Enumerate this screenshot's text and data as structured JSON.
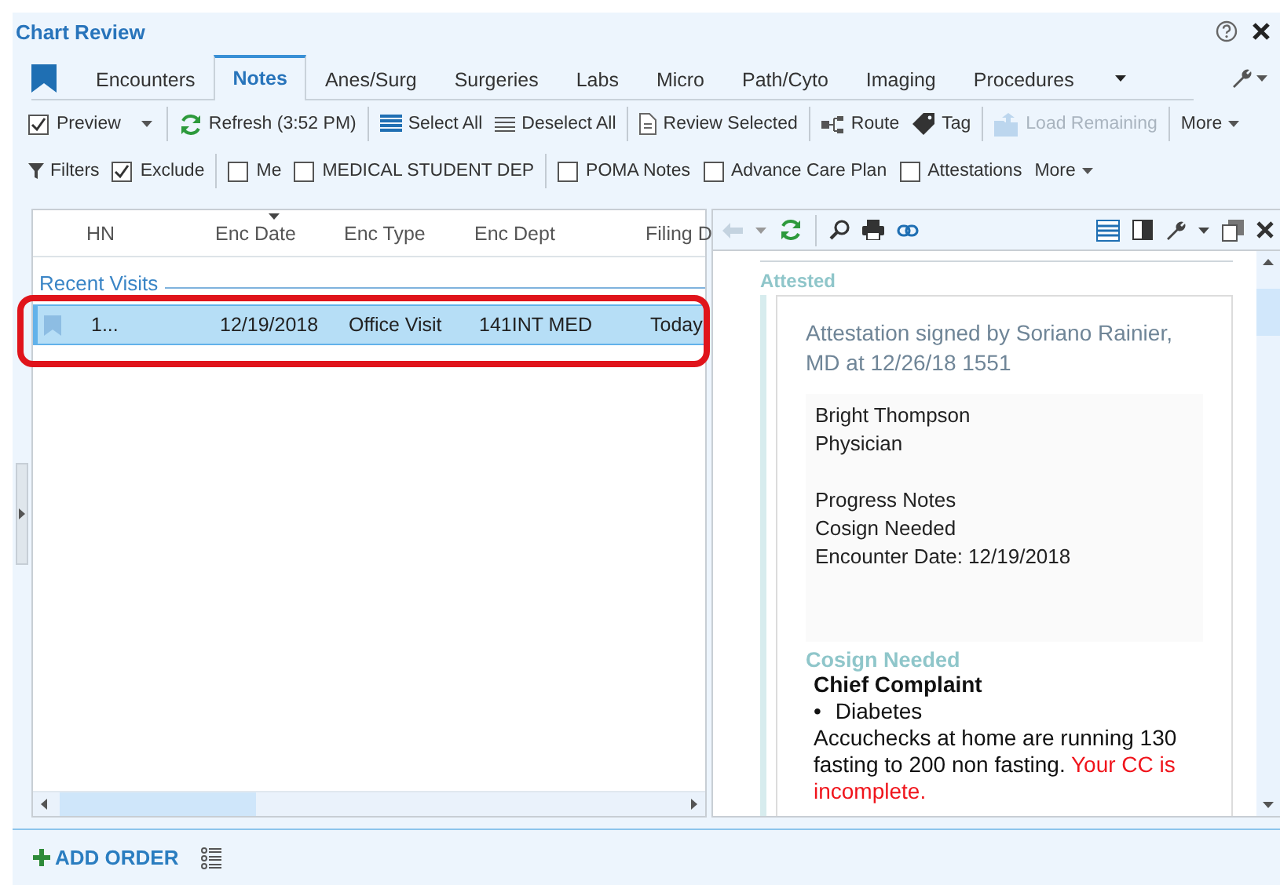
{
  "window": {
    "title": "Chart Review"
  },
  "tabs": [
    {
      "label": "Encounters",
      "selected": false
    },
    {
      "label": "Notes",
      "selected": true
    },
    {
      "label": "Anes/Surg",
      "selected": false
    },
    {
      "label": "Surgeries",
      "selected": false
    },
    {
      "label": "Labs",
      "selected": false
    },
    {
      "label": "Micro",
      "selected": false
    },
    {
      "label": "Path/Cyto",
      "selected": false
    },
    {
      "label": "Imaging",
      "selected": false
    },
    {
      "label": "Procedures",
      "selected": false
    }
  ],
  "toolbar": {
    "items": [
      {
        "kind": "checkbox",
        "label": "Preview",
        "checked": true,
        "dropdown": true
      },
      {
        "kind": "separator"
      },
      {
        "kind": "button",
        "label": "Refresh (3:52 PM)",
        "disabled": false
      },
      {
        "kind": "separator"
      },
      {
        "kind": "button",
        "label": "Select All",
        "disabled": false
      },
      {
        "kind": "button",
        "label": "Deselect All",
        "disabled": false
      },
      {
        "kind": "separator"
      },
      {
        "kind": "button",
        "label": "Review Selected",
        "disabled": false
      },
      {
        "kind": "separator"
      },
      {
        "kind": "button",
        "label": "Route",
        "disabled": false
      },
      {
        "kind": "button",
        "label": "Tag",
        "disabled": false
      },
      {
        "kind": "separator"
      },
      {
        "kind": "button",
        "label": "Load Remaining",
        "disabled": true
      },
      {
        "kind": "separator"
      },
      {
        "kind": "menu",
        "label": "More"
      }
    ]
  },
  "filters": {
    "items": [
      {
        "kind": "filter",
        "label": "Filters"
      },
      {
        "kind": "checkbox",
        "label": "Exclude",
        "checked": true
      },
      {
        "kind": "separator"
      },
      {
        "kind": "checkbox",
        "label": "Me",
        "checked": false
      },
      {
        "kind": "checkbox",
        "label": "MEDICAL STUDENT DEP",
        "checked": false
      },
      {
        "kind": "separator"
      },
      {
        "kind": "checkbox",
        "label": "POMA Notes",
        "checked": false
      },
      {
        "kind": "checkbox",
        "label": "Advance Care Plan",
        "checked": false
      },
      {
        "kind": "checkbox",
        "label": "Attestations",
        "checked": false
      },
      {
        "kind": "menu",
        "label": "More"
      }
    ]
  },
  "encounters": {
    "columns": [
      "HN",
      "Enc Date",
      "Enc Type",
      "Enc Dept",
      "Filing D"
    ],
    "group": "Recent Visits",
    "rows": [
      {
        "cells": [
          "1...",
          "12/19/2018",
          "Office Visit",
          "141INT MED",
          "Today"
        ],
        "selected": true,
        "highlighted": true
      }
    ]
  },
  "note": {
    "status_label": "Attested",
    "attestation": "Attestation signed by Soriano Rainier, MD at 12/26/18 1551",
    "header_groups": [
      [
        "Bright Thompson",
        "Physician"
      ],
      [
        "Progress Notes",
        "Cosign Needed",
        "Encounter Date:  12/19/2018"
      ]
    ],
    "section_label": "Cosign Needed",
    "heading": "Chief Complaint",
    "bullets": [
      {
        "mark": "•",
        "text": "Diabetes"
      }
    ],
    "body": "Accuchecks at home are running 130 fasting to 200 non fasting. ",
    "warning": "Your CC is incomplete."
  },
  "footer": {
    "action": "ADD ORDER"
  }
}
